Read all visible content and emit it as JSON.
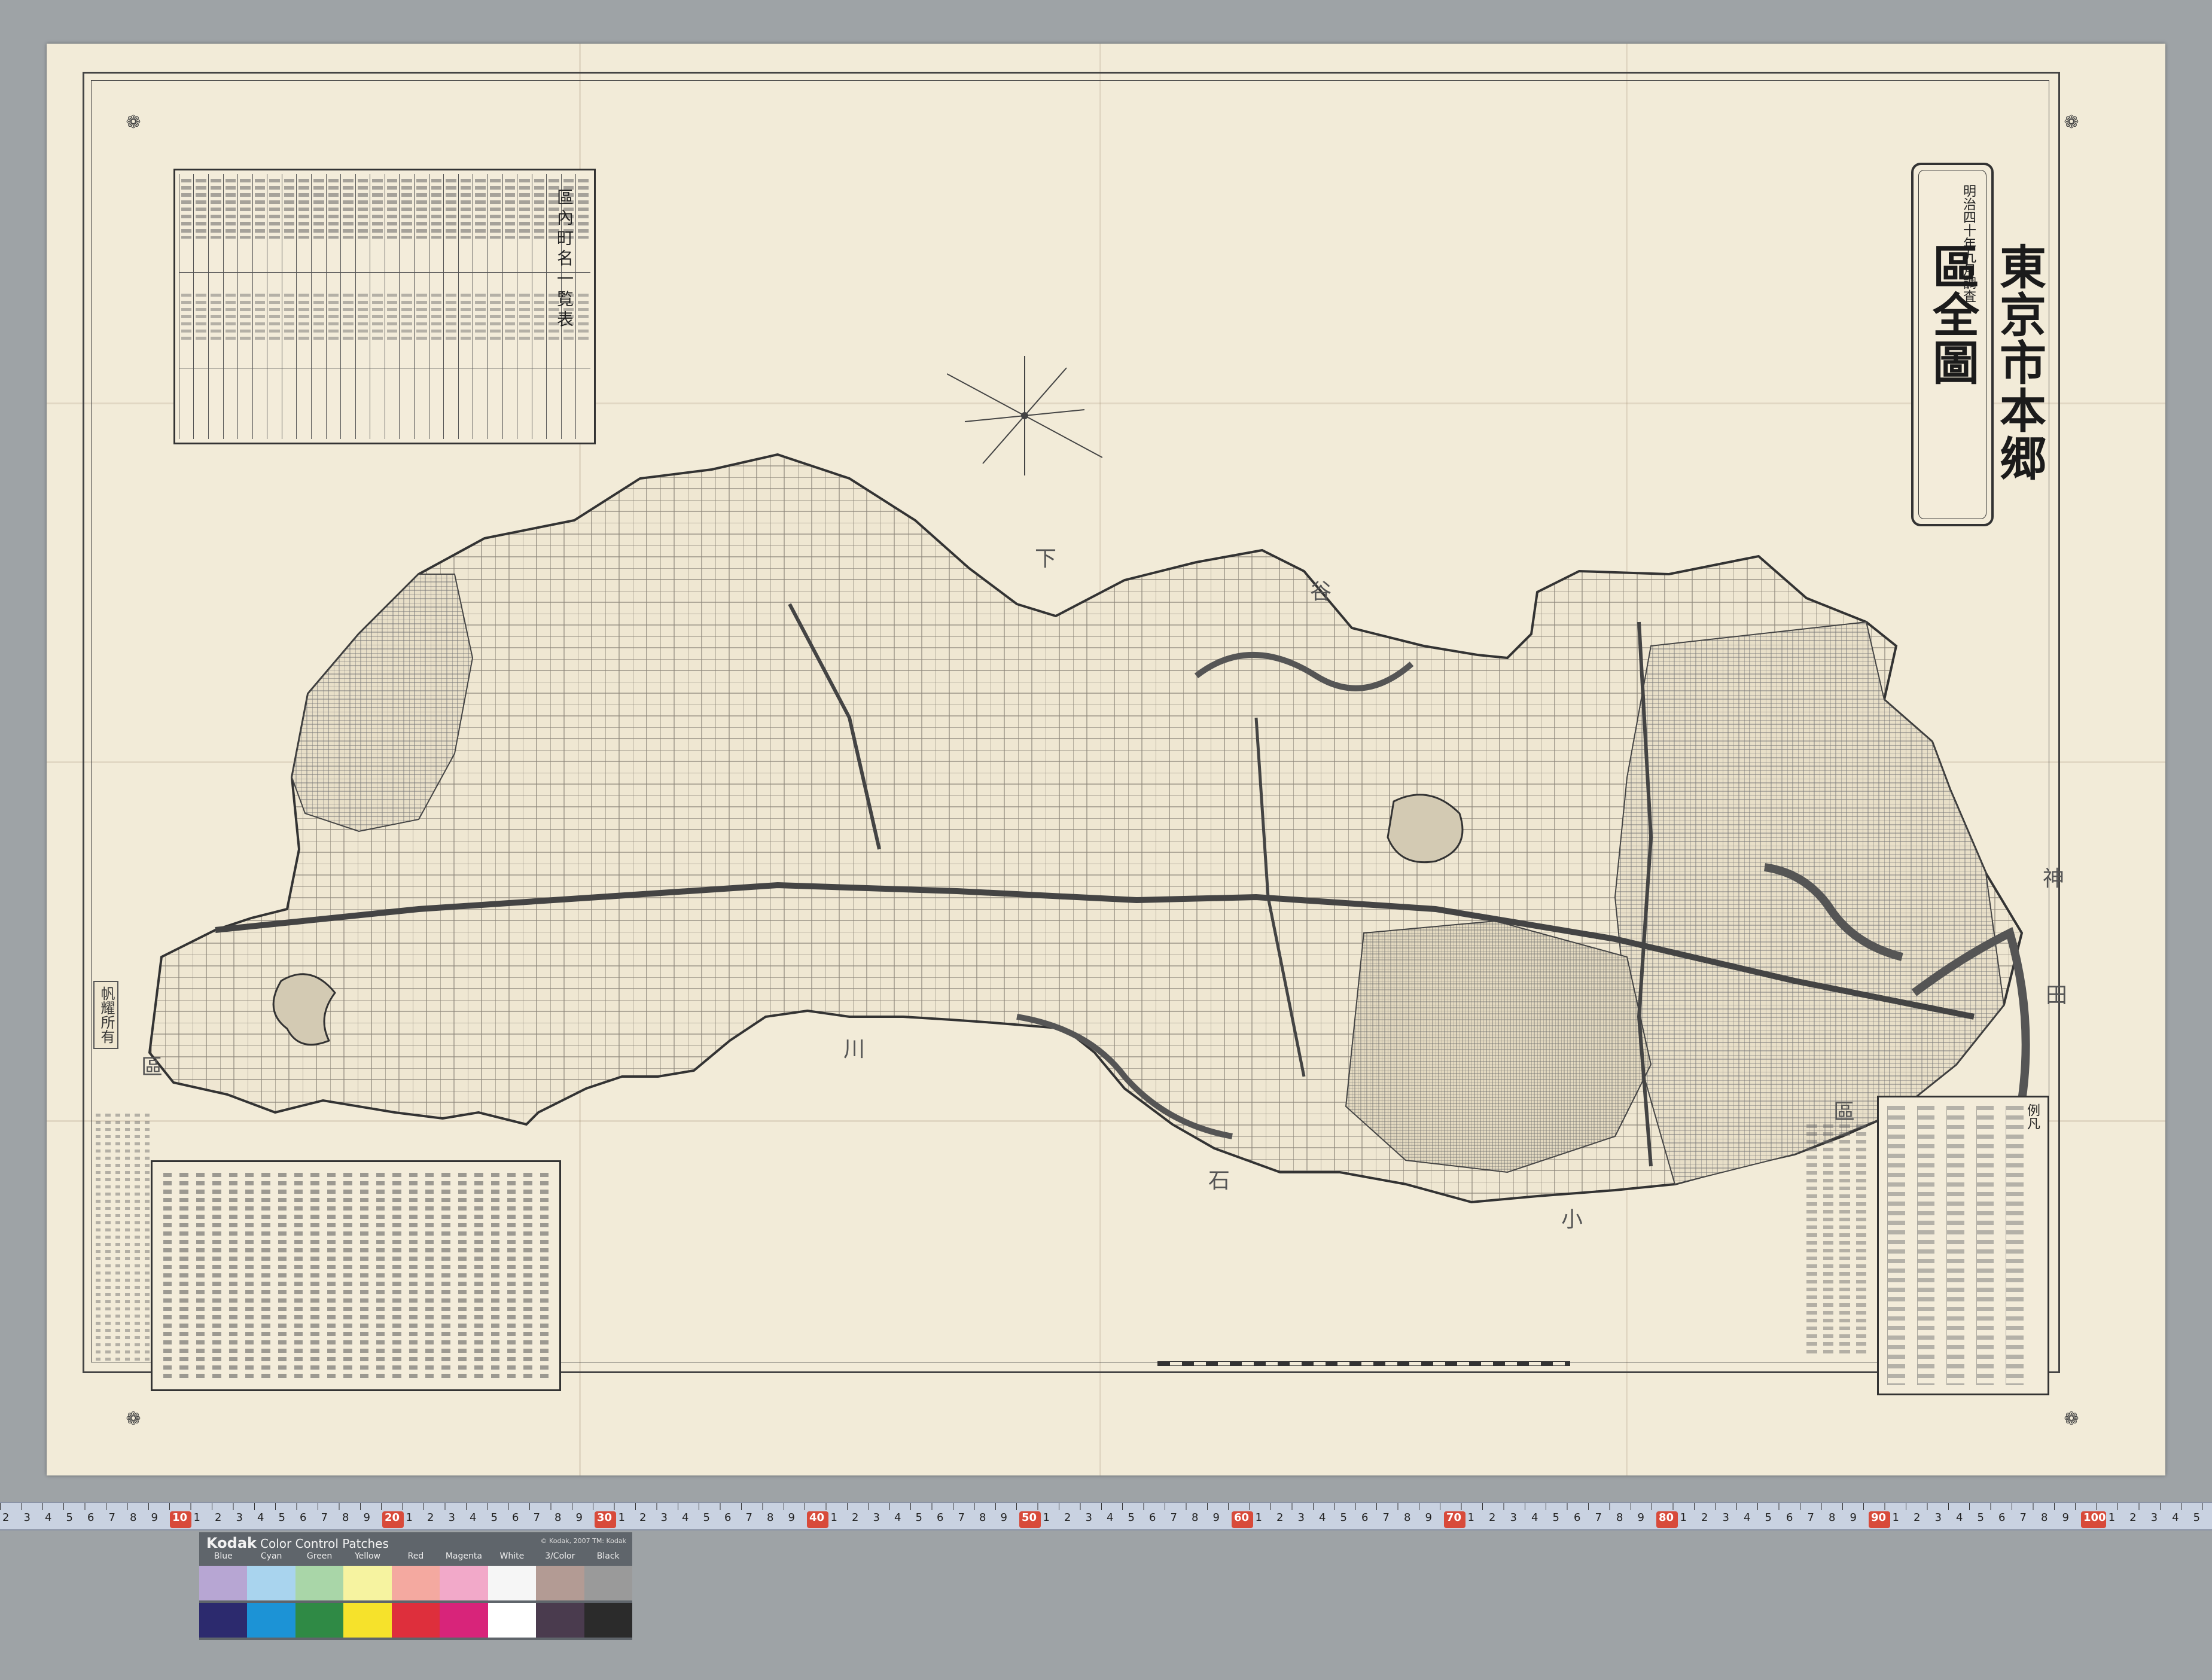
{
  "map": {
    "title": "東京市本郷區全圖",
    "subtitle": "明治四十年九月調査",
    "index_title": "區內町名一覧表",
    "legend_title": "例凡",
    "stamp_text": "帆耀所有",
    "district_labels": [
      {
        "text": "石",
        "area": "south"
      },
      {
        "text": "川",
        "area": "southwest"
      },
      {
        "text": "區",
        "area": "west"
      },
      {
        "text": "小",
        "area": "south-center"
      },
      {
        "text": "下",
        "area": "north"
      },
      {
        "text": "谷",
        "area": "north"
      },
      {
        "text": "區",
        "area": "southeast"
      },
      {
        "text": "神",
        "area": "east"
      },
      {
        "text": "田",
        "area": "east"
      }
    ]
  },
  "ruler": {
    "marks": [
      "2",
      "3",
      "4",
      "5",
      "6",
      "7",
      "8",
      "9",
      "10",
      "1",
      "2",
      "3",
      "4",
      "5",
      "6",
      "7",
      "8",
      "9",
      "20",
      "1",
      "2",
      "3",
      "4",
      "5",
      "6",
      "7",
      "8",
      "9",
      "30",
      "1",
      "2",
      "3",
      "4",
      "5",
      "6",
      "7",
      "8",
      "9",
      "40",
      "1",
      "2",
      "3",
      "4",
      "5",
      "6",
      "7",
      "8",
      "9",
      "50",
      "1",
      "2",
      "3",
      "4",
      "5",
      "6",
      "7",
      "8",
      "9",
      "60",
      "1",
      "2",
      "3",
      "4",
      "5",
      "6",
      "7",
      "8",
      "9",
      "70",
      "1",
      "2",
      "3",
      "4",
      "5",
      "6",
      "7",
      "8",
      "9",
      "80",
      "1",
      "2",
      "3",
      "4",
      "5",
      "6",
      "7",
      "8",
      "9",
      "90",
      "1",
      "2",
      "3",
      "4",
      "5",
      "6",
      "7",
      "8",
      "9",
      "100",
      "1",
      "2",
      "3",
      "4",
      "5"
    ],
    "major_marks": [
      "10",
      "20",
      "30",
      "40",
      "50",
      "60",
      "70",
      "80",
      "90",
      "100"
    ]
  },
  "color_card": {
    "brand": "Kodak",
    "name": "Color Control Patches",
    "copyright": "© Kodak, 2007 TM: Kodak",
    "labels": [
      "Blue",
      "Cyan",
      "Green",
      "Yellow",
      "Red",
      "Magenta",
      "White",
      "3/Color",
      "Black"
    ],
    "top_colors": [
      "#b7a6d3",
      "#a9d4ee",
      "#a9d6a8",
      "#f6f3a0",
      "#f4a9a0",
      "#f2a9c9",
      "#f6f6f6",
      "#b39b94",
      "#9a9a9a"
    ],
    "bottom_colors": [
      "#2c2a6e",
      "#1c93d6",
      "#2f8a45",
      "#f6e22b",
      "#de2f3c",
      "#d8247a",
      "#ffffff",
      "#4a3b4e",
      "#2b2b2b"
    ]
  }
}
